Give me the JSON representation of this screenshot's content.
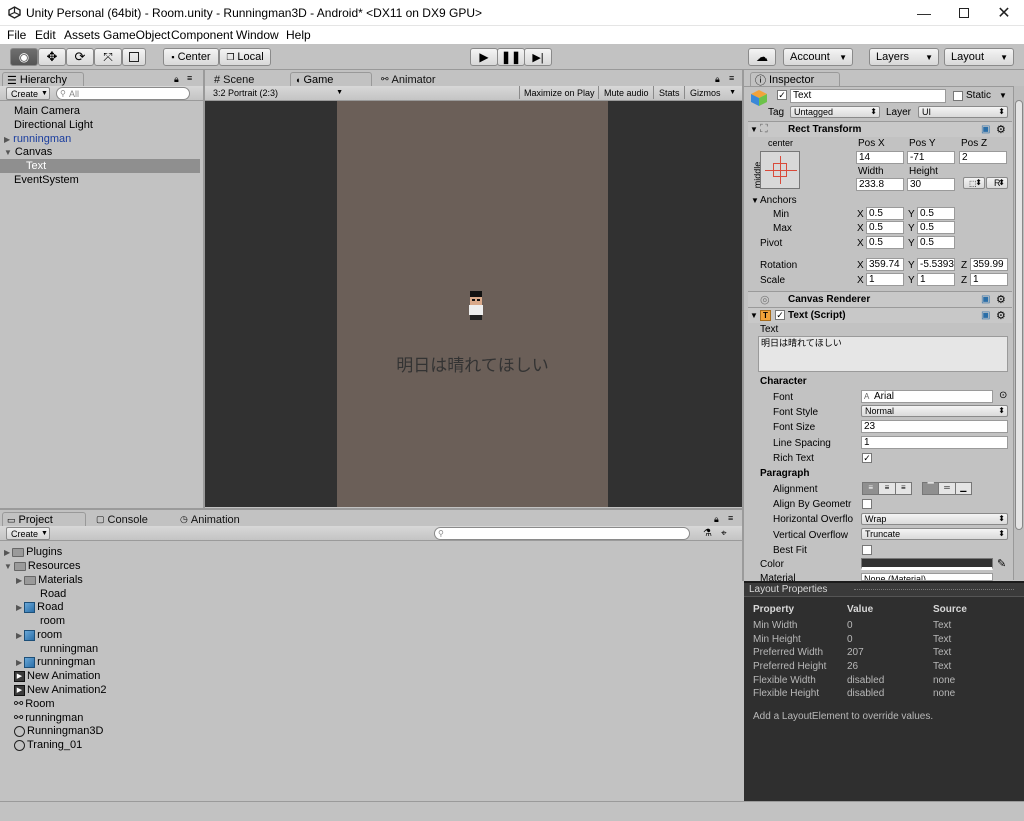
{
  "window": {
    "title": "Unity Personal (64bit) - Room.unity - Runningman3D - Android* <DX11 on DX9 GPU>"
  },
  "menu": [
    "File",
    "Edit",
    "Assets",
    "GameObject",
    "Component",
    "Window",
    "Help"
  ],
  "toolbar": {
    "pivot_label": "Center",
    "space_label": "Local",
    "account_label": "Account",
    "layers_label": "Layers",
    "layout_label": "Layout"
  },
  "hierarchy": {
    "tab": "Hierarchy",
    "create": "Create",
    "search_placeholder": "All",
    "items": [
      {
        "label": "Main Camera"
      },
      {
        "label": "Directional Light"
      },
      {
        "label": "runningman"
      },
      {
        "label": "Canvas"
      },
      {
        "label": "Text"
      },
      {
        "label": "EventSystem"
      }
    ]
  },
  "center_tabs": {
    "scene": "Scene",
    "game": "Game",
    "animator": "Animator"
  },
  "game": {
    "aspect": "3:2 Portrait (2:3)",
    "maximize": "Maximize on Play",
    "mute": "Mute audio",
    "stats": "Stats",
    "gizmos": "Gizmos",
    "ui_text": "明日は晴れてほしい"
  },
  "project": {
    "tabs": {
      "project": "Project",
      "console": "Console",
      "animation": "Animation"
    },
    "create": "Create",
    "items": [
      {
        "label": "Plugins"
      },
      {
        "label": "Resources"
      },
      {
        "label": "Materials"
      },
      {
        "label": "Road"
      },
      {
        "label": "Road"
      },
      {
        "label": "room"
      },
      {
        "label": "room"
      },
      {
        "label": "runningman"
      },
      {
        "label": "runningman"
      },
      {
        "label": "New Animation"
      },
      {
        "label": "New Animation2"
      },
      {
        "label": "Room"
      },
      {
        "label": "runningman"
      },
      {
        "label": "Runningman3D"
      },
      {
        "label": "Traning_01"
      }
    ]
  },
  "inspector": {
    "tab": "Inspector",
    "object_name": "Text",
    "static_label": "Static",
    "tag_label": "Tag",
    "tag_value": "Untagged",
    "layer_label": "Layer",
    "layer_value": "UI",
    "rect": {
      "title": "Rect Transform",
      "anchor_h": "center",
      "anchor_v": "middle",
      "posx_label": "Pos X",
      "posy_label": "Pos Y",
      "posz_label": "Pos Z",
      "posx": "14",
      "posy": "-71",
      "posz": "2",
      "width_label": "Width",
      "height_label": "Height",
      "width": "233.8",
      "height": "30",
      "r_button": "R",
      "anchors_label": "Anchors",
      "min_label": "Min",
      "min_x": "0.5",
      "min_y": "0.5",
      "max_label": "Max",
      "max_x": "0.5",
      "max_y": "0.5",
      "pivot_label": "Pivot",
      "pivot_x": "0.5",
      "pivot_y": "0.5",
      "rotation_label": "Rotation",
      "rot_x": "359.74",
      "rot_y": "-5.5393",
      "rot_z": "359.99",
      "scale_label": "Scale",
      "scale_x": "1",
      "scale_y": "1",
      "scale_z": "1",
      "x": "X",
      "y": "Y",
      "z": "Z"
    },
    "canvas_renderer": {
      "title": "Canvas Renderer"
    },
    "text_script": {
      "title": "Text (Script)",
      "text_label": "Text",
      "text_value": "明日は晴れてほしい",
      "character": "Character",
      "font_label": "Font",
      "font_value": "Arial",
      "font_style_label": "Font Style",
      "font_style_value": "Normal",
      "font_size_label": "Font Size",
      "font_size_value": "23",
      "line_spacing_label": "Line Spacing",
      "line_spacing_value": "1",
      "rich_text_label": "Rich Text",
      "paragraph": "Paragraph",
      "alignment_label": "Alignment",
      "align_geometry_label": "Align By Geometr",
      "h_overflow_label": "Horizontal Overflo",
      "h_overflow_value": "Wrap",
      "v_overflow_label": "Vertical Overflow",
      "v_overflow_value": "Truncate",
      "best_fit_label": "Best Fit",
      "color_label": "Color",
      "material_label": "Material",
      "material_value": "None (Material)"
    }
  },
  "layout_properties": {
    "title": "Layout Properties",
    "headers": [
      "Property",
      "Value",
      "Source"
    ],
    "rows": [
      [
        "Min Width",
        "0",
        "Text"
      ],
      [
        "Min Height",
        "0",
        "Text"
      ],
      [
        "Preferred Width",
        "207",
        "Text"
      ],
      [
        "Preferred Height",
        "26",
        "Text"
      ],
      [
        "Flexible Width",
        "disabled",
        "none"
      ],
      [
        "Flexible Height",
        "disabled",
        "none"
      ]
    ],
    "note": "Add a LayoutElement to override values."
  },
  "colors": {
    "game_bg": "#6b5f58",
    "game_letterbox": "#313131",
    "selected_row": "#8f8f8f",
    "link_blue": "#1a3d9e",
    "layout_bg": "#2f2f2f"
  }
}
